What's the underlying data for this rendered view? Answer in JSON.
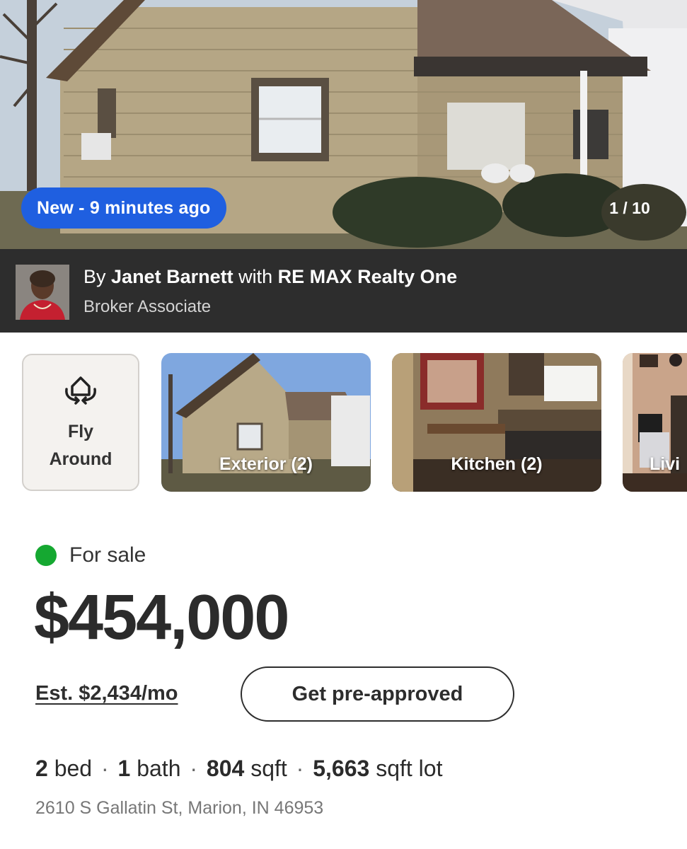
{
  "hero": {
    "badge": "New - 9 minutes ago",
    "photo_counter": "1 / 10"
  },
  "agent": {
    "by": "By",
    "name": "Janet Barnett",
    "with": "with",
    "brokerage": "RE MAX Realty One",
    "title": "Broker Associate"
  },
  "carousel": {
    "fly_around_label_line1": "Fly",
    "fly_around_label_line2": "Around",
    "items": [
      {
        "label": "Exterior (2)"
      },
      {
        "label": "Kitchen (2)"
      },
      {
        "label": "Livi"
      }
    ]
  },
  "listing": {
    "status": "For sale",
    "status_color": "#15a831",
    "price": "$454,000",
    "estimate": "Est. $2,434/mo",
    "preapproved_button": "Get pre-approved",
    "beds": "2",
    "beds_unit": "bed",
    "baths": "1",
    "baths_unit": "bath",
    "sqft": "804",
    "sqft_unit": "sqft",
    "lot": "5,663",
    "lot_unit": "sqft lot",
    "separator": "·",
    "address": "2610 S Gallatin St, Marion, IN 46953"
  },
  "colors": {
    "badge_blue": "#1f5fe0",
    "agent_bar": "#2d2d2d"
  },
  "icons": {
    "fly_around": "rotate-3d-house-icon"
  }
}
